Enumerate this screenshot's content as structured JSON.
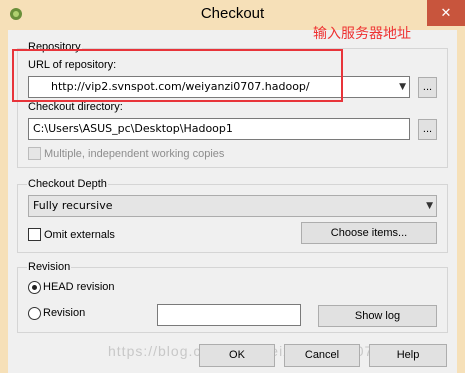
{
  "window": {
    "title": "Checkout",
    "close_glyph": "✕"
  },
  "annotation_text": "输入服务器地址",
  "repository": {
    "group_label": "Repository",
    "url_label": "URL of repository:",
    "url_value": "http://vip2.svnspot.com/weiyanzi0707.hadoop/",
    "browse_label": "...",
    "dir_label": "Checkout directory:",
    "dir_value": "C:\\Users\\ASUS_pc\\Desktop\\Hadoop1",
    "multiple_label": "Multiple, independent working copies"
  },
  "depth": {
    "group_label": "Checkout Depth",
    "selected": "Fully recursive",
    "omit_label": "Omit externals",
    "choose_items_label": "Choose items..."
  },
  "revision": {
    "group_label": "Revision",
    "head_label": "HEAD revision",
    "revision_label": "Revision",
    "revision_value": "",
    "show_log_label": "Show log"
  },
  "footer": {
    "ok_label": "OK",
    "cancel_label": "Cancel",
    "help_label": "Help"
  },
  "watermark": "https://blog.csdn.net/weixin_43116071123",
  "colors": {
    "title_bar": "#f6e0b8",
    "close": "#c8553d",
    "highlight": "#e8343a",
    "annotation": "#ee3333"
  }
}
